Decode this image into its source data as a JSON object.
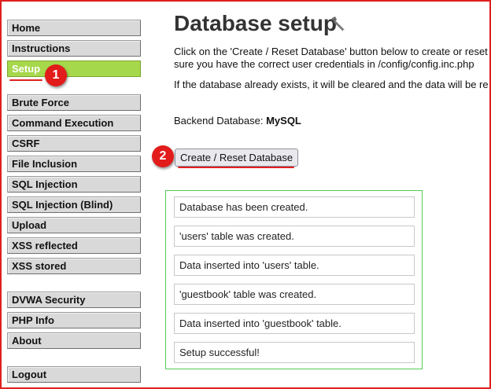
{
  "sidebar": {
    "items": [
      {
        "label": "Home"
      },
      {
        "label": "Instructions"
      },
      {
        "label": "Setup",
        "selected": true
      },
      {
        "label": "Brute Force"
      },
      {
        "label": "Command Execution"
      },
      {
        "label": "CSRF"
      },
      {
        "label": "File Inclusion"
      },
      {
        "label": "SQL Injection"
      },
      {
        "label": "SQL Injection (Blind)"
      },
      {
        "label": "Upload"
      },
      {
        "label": "XSS reflected"
      },
      {
        "label": "XSS stored"
      },
      {
        "label": "DVWA Security"
      },
      {
        "label": "PHP Info"
      },
      {
        "label": "About"
      },
      {
        "label": "Logout"
      }
    ]
  },
  "annotations": {
    "callout_1": "1",
    "callout_2": "2",
    "accent_color": "#e21b1b"
  },
  "main": {
    "title": "Database setup",
    "title_icon": "wrench-icon",
    "intro_line_1": "Click on the 'Create / Reset Database' button below to create or reset",
    "intro_line_2": "sure you have the correct user credentials in /config/config.inc.php",
    "warning": "If the database already exists, it will be cleared and the data will be re",
    "backend_label": "Backend Database:",
    "backend_value": "MySQL",
    "create_button_label": "Create / Reset Database",
    "messages": [
      "Database has been created.",
      "'users' table was created.",
      "Data inserted into 'users' table.",
      "'guestbook' table was created.",
      "Data inserted into 'guestbook' table.",
      "Setup successful!"
    ]
  },
  "colors": {
    "selected_menu": "#a6d84b",
    "results_border": "#55cc55",
    "frame_border": "#e02020"
  }
}
